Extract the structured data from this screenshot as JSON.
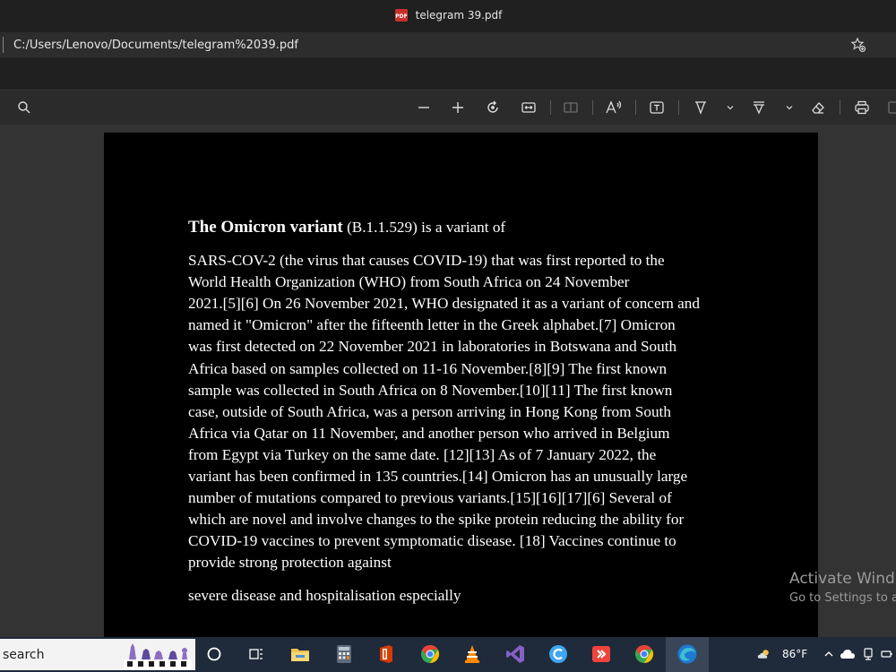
{
  "window": {
    "title": "telegram 39.pdf",
    "pdf_badge": "PDF"
  },
  "address": {
    "url": "C:/Users/Lenovo/Documents/telegram%2039.pdf"
  },
  "document": {
    "heading_bold": "The Omicron variant",
    "heading_rest": " (B.1.1.529) is a variant of",
    "lines": [
      "SARS-COV-2 (the virus that causes COVID-19) that was first reported to the",
      "World Health Organization (WHO) from South Africa on 24 November",
      "2021.[5][6] On 26 November 2021, WHO designated it as a variant of concern and",
      "named it \"Omicron\" after the fifteenth letter in the Greek alphabet.[7] Omicron",
      "was first detected on 22 November 2021 in laboratories in Botswana and South",
      "Africa based on samples collected on 11-16 November.[8][9] The first known",
      "sample was collected in South Africa on 8 November.[10][11] The first known",
      "case, outside of South Africa, was a person arriving in Hong Kong from South",
      "Africa via Qatar on 11 November, and another person who arrived in Belgium",
      "from Egypt via Turkey on the same date. [12][13] As of 7 January 2022, the",
      "variant has been confirmed in 135 countries.[14] Omicron has an unusually large",
      "number of mutations compared to previous variants.[15][16][17][6] Several of",
      "which are novel and involve changes to the spike protein reducing the ability for",
      "COVID-19 vaccines to prevent symptomatic disease. [18] Vaccines continue to",
      "provide strong protection against"
    ],
    "last_line": "severe disease and hospitalisation especially"
  },
  "watermark": {
    "title": "Activate Wind",
    "subtitle": "Go to Settings to a"
  },
  "taskbar": {
    "search_text": "search",
    "temperature": "86°F"
  },
  "colors": {
    "edge_blue": "#1f7ad4",
    "chrome_green": "#34a853",
    "chrome_red": "#ea4335",
    "chrome_yellow": "#fbbc05",
    "office_orange": "#d83b01",
    "vlc_orange": "#ff8800"
  }
}
